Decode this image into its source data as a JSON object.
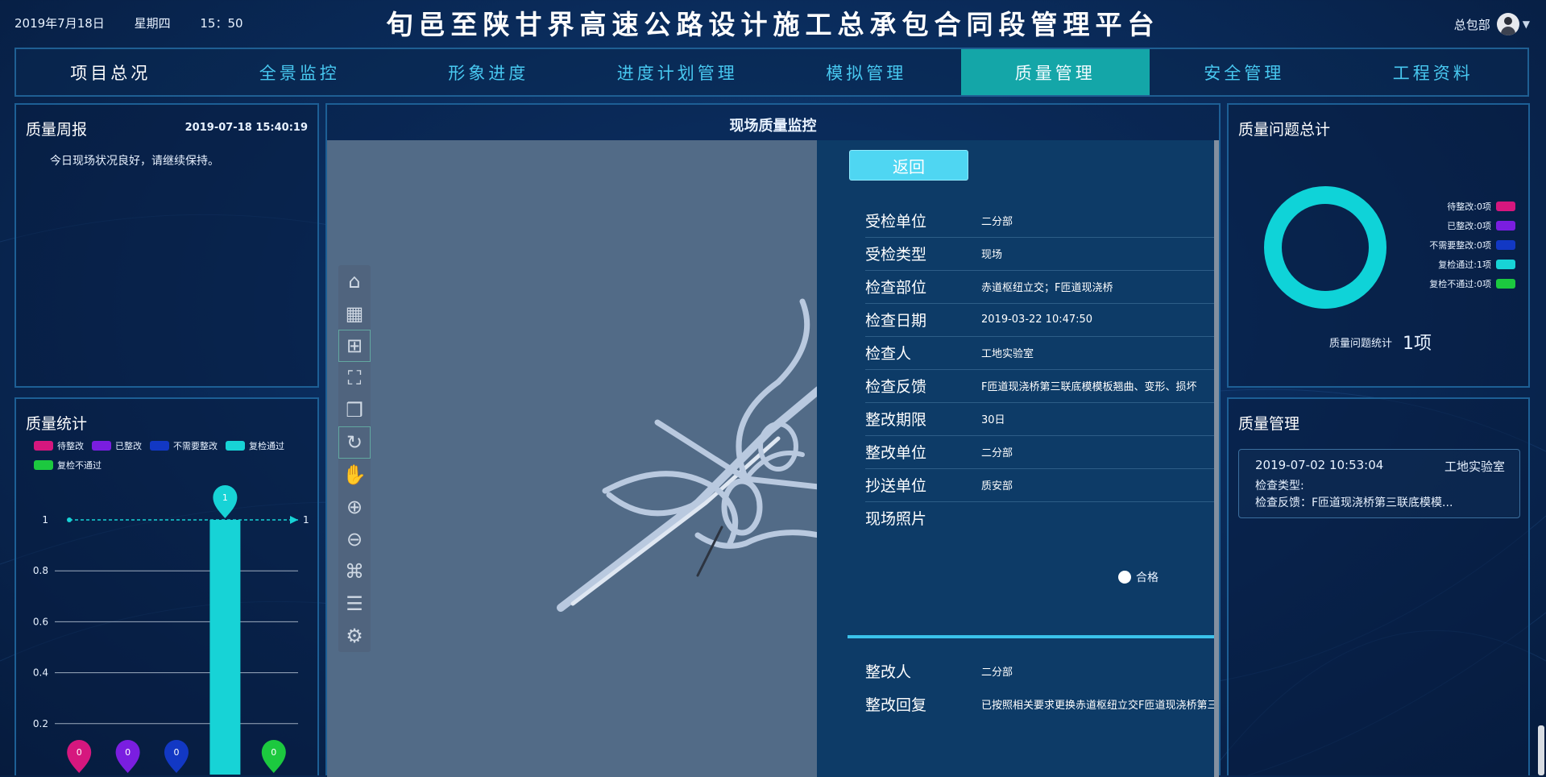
{
  "header": {
    "date": "2019年7月18日",
    "weekday": "星期四",
    "time": "15：50",
    "title": "旬邑至陕甘界高速公路设计施工总承包合同段管理平台",
    "user": "总包部"
  },
  "nav": [
    {
      "label": "项目总况"
    },
    {
      "label": "全景监控"
    },
    {
      "label": "形象进度"
    },
    {
      "label": "进度计划管理"
    },
    {
      "label": "模拟管理"
    },
    {
      "label": "质量管理",
      "active": true
    },
    {
      "label": "安全管理"
    },
    {
      "label": "工程资料"
    }
  ],
  "weekly": {
    "title": "质量周报",
    "timestamp": "2019-07-18 15:40:19",
    "text": "今日现场状况良好，请继续保持。"
  },
  "stats": {
    "title": "质量统计",
    "legend": [
      {
        "name": "待整改",
        "color": "#d6177e"
      },
      {
        "name": "已整改",
        "color": "#7a1ee0"
      },
      {
        "name": "不需要整改",
        "color": "#1238c4"
      },
      {
        "name": "复检通过",
        "color": "#17d3d6"
      },
      {
        "name": "复检不通过",
        "color": "#1cc93f"
      }
    ]
  },
  "chart_data": {
    "type": "bar",
    "categories": [
      "待整改",
      "已整改",
      "不需要整改",
      "复检通过",
      "复检不通过"
    ],
    "values": [
      0,
      0,
      0,
      1,
      0
    ],
    "colors": [
      "#d6177e",
      "#7a1ee0",
      "#1238c4",
      "#17d3d6",
      "#1cc93f"
    ],
    "y_ticks": [
      "0.2",
      "0.4",
      "0.6",
      "0.8",
      "1"
    ],
    "ylim": [
      0,
      1
    ],
    "markline_label": "1",
    "data_labels": [
      "0",
      "0",
      "0",
      "1",
      "0"
    ]
  },
  "center": {
    "title": "现场质量监控",
    "back_label": "返回",
    "tools": [
      "home-icon",
      "windows-icon",
      "layout-grid-icon",
      "fullscreen-icon",
      "cube-icon",
      "rotate-icon",
      "hand-icon",
      "zoom-in-icon",
      "zoom-out-icon",
      "tree-icon",
      "list-icon",
      "settings-icon"
    ],
    "fields": [
      {
        "label": "受检单位",
        "value": "二分部"
      },
      {
        "label": "受检类型",
        "value": "现场"
      },
      {
        "label": "检查部位",
        "value": "赤道枢纽立交；F匝道现浇桥"
      },
      {
        "label": "检查日期",
        "value": "2019-03-22 10:47:50"
      },
      {
        "label": "检查人",
        "value": "工地实验室"
      },
      {
        "label": "检查反馈",
        "value": "F匝道现浇桥第三联底模模板翘曲、变形、损坏"
      },
      {
        "label": "整改期限",
        "value": "30日"
      },
      {
        "label": "整改单位",
        "value": "二分部"
      },
      {
        "label": "抄送单位",
        "value": "质安部"
      },
      {
        "label": "现场照片",
        "value": ""
      }
    ],
    "pass_label": "合格",
    "rectify": [
      {
        "label": "整改人",
        "value": "二分部"
      },
      {
        "label": "整改回复",
        "value": "已按照相关要求更换赤道枢纽立交F匝道现浇桥第三联底模模板"
      }
    ]
  },
  "total": {
    "title": "质量问题总计",
    "legend": [
      {
        "text": "待整改:0项",
        "color": "#d6177e"
      },
      {
        "text": "已整改:0项",
        "color": "#7a1ee0"
      },
      {
        "text": "不需要整改:0项",
        "color": "#1238c4"
      },
      {
        "text": "复检通过:1项",
        "color": "#17d3d6"
      },
      {
        "text": "复检不通过:0项",
        "color": "#1cc93f"
      }
    ],
    "summary_label": "质量问题统计",
    "summary_value": "1项",
    "ring_color": "#0fd3d8"
  },
  "mgmt": {
    "title": "质量管理",
    "record": {
      "time": "2019-07-02 10:53:04",
      "inspector": "工地实验室",
      "type_label": "检查类型:",
      "feedback": "检查反馈：F匝道现浇桥第三联底模模..."
    }
  }
}
